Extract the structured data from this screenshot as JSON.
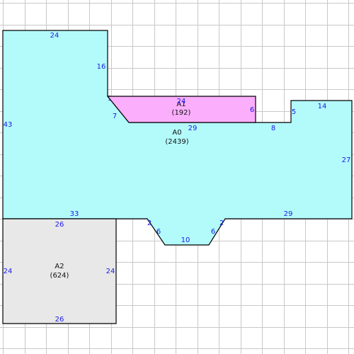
{
  "colors": {
    "background": "#ffffff",
    "grid": "#c8c8c8",
    "outline": "#000000",
    "dimension_text": "#1a1ae6",
    "room_text": "#111111"
  },
  "rooms": [
    {
      "id": "a0",
      "name": "A0",
      "area": "(2439)",
      "fill": "#b3fbfb",
      "dimensions": [
        "24",
        "16",
        "1",
        "7",
        "29",
        "8",
        "5",
        "14",
        "27",
        "29",
        "2",
        "6",
        "10",
        "6",
        "2",
        "33",
        "43"
      ]
    },
    {
      "id": "a1",
      "name": "A1",
      "area": "(192)",
      "fill": "#fbaefb",
      "dimensions": [
        "24",
        "6"
      ]
    },
    {
      "id": "a2",
      "name": "A2",
      "area": "(624)",
      "fill": "#e8e8e8",
      "dimensions": [
        "26",
        "24",
        "24",
        "26"
      ]
    }
  ]
}
